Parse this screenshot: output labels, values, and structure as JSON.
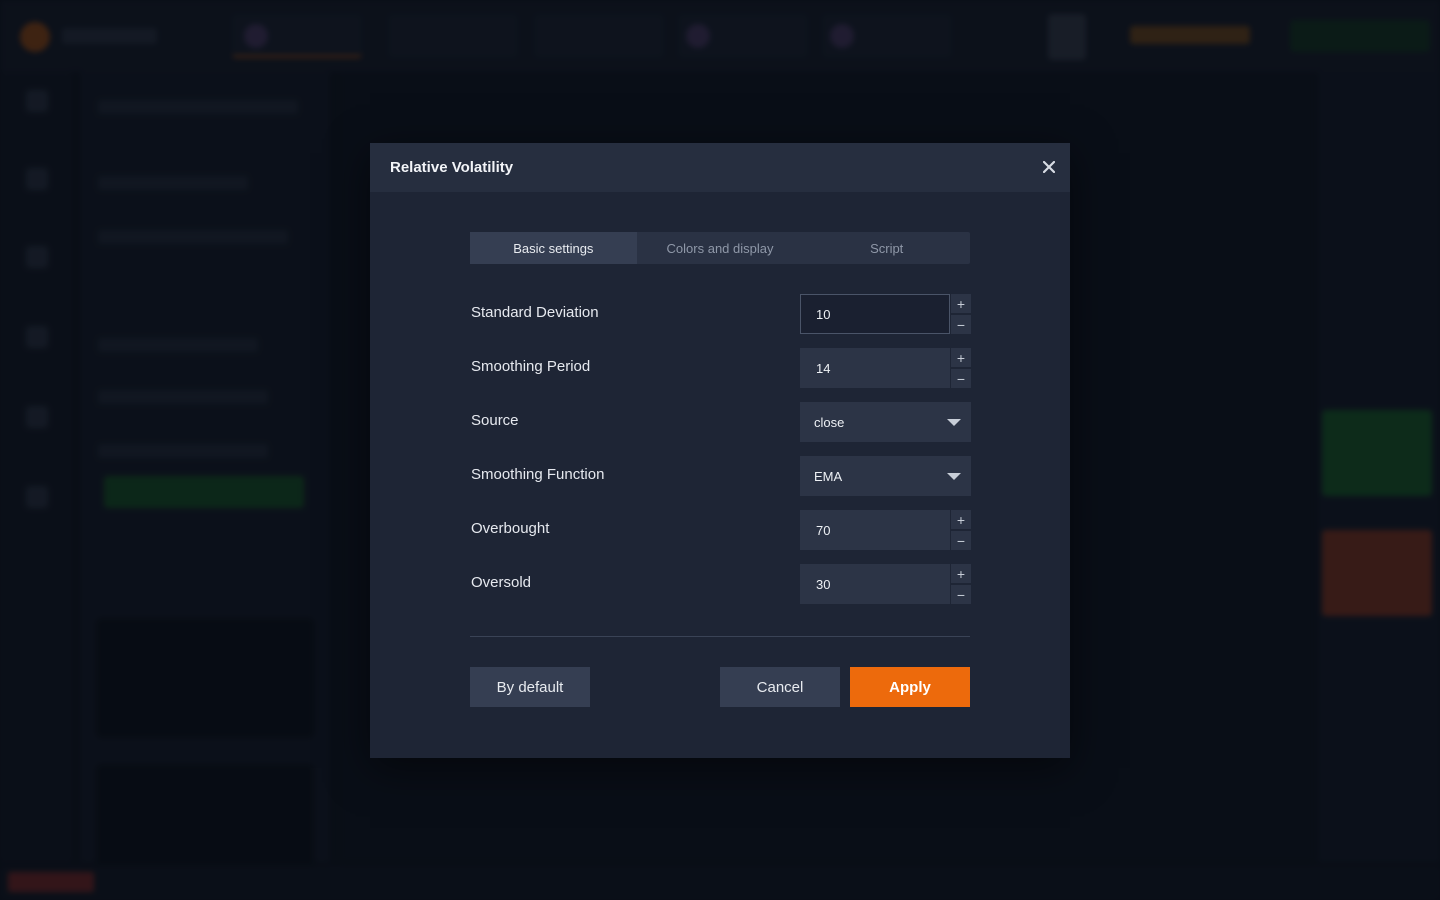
{
  "dialog": {
    "title": "Relative Volatility",
    "close_icon": "close-icon"
  },
  "tabs": [
    {
      "label": "Basic settings",
      "active": true
    },
    {
      "label": "Colors and display",
      "active": false
    },
    {
      "label": "Script",
      "active": false
    }
  ],
  "fields": {
    "standard_deviation": {
      "label": "Standard Deviation",
      "value": "10"
    },
    "smoothing_period": {
      "label": "Smoothing Period",
      "value": "14"
    },
    "source": {
      "label": "Source",
      "value": "close"
    },
    "smoothing_function": {
      "label": "Smoothing Function",
      "value": "EMA"
    },
    "overbought": {
      "label": "Overbought",
      "value": "70"
    },
    "oversold": {
      "label": "Oversold",
      "value": "30"
    }
  },
  "stepper": {
    "plus": "+",
    "minus": "−"
  },
  "buttons": {
    "default_label": "By default",
    "cancel_label": "Cancel",
    "apply_label": "Apply"
  },
  "colors": {
    "accent": "#ed6a0c",
    "dialog_bg": "#1e2535",
    "header_bg": "#262e3f"
  }
}
